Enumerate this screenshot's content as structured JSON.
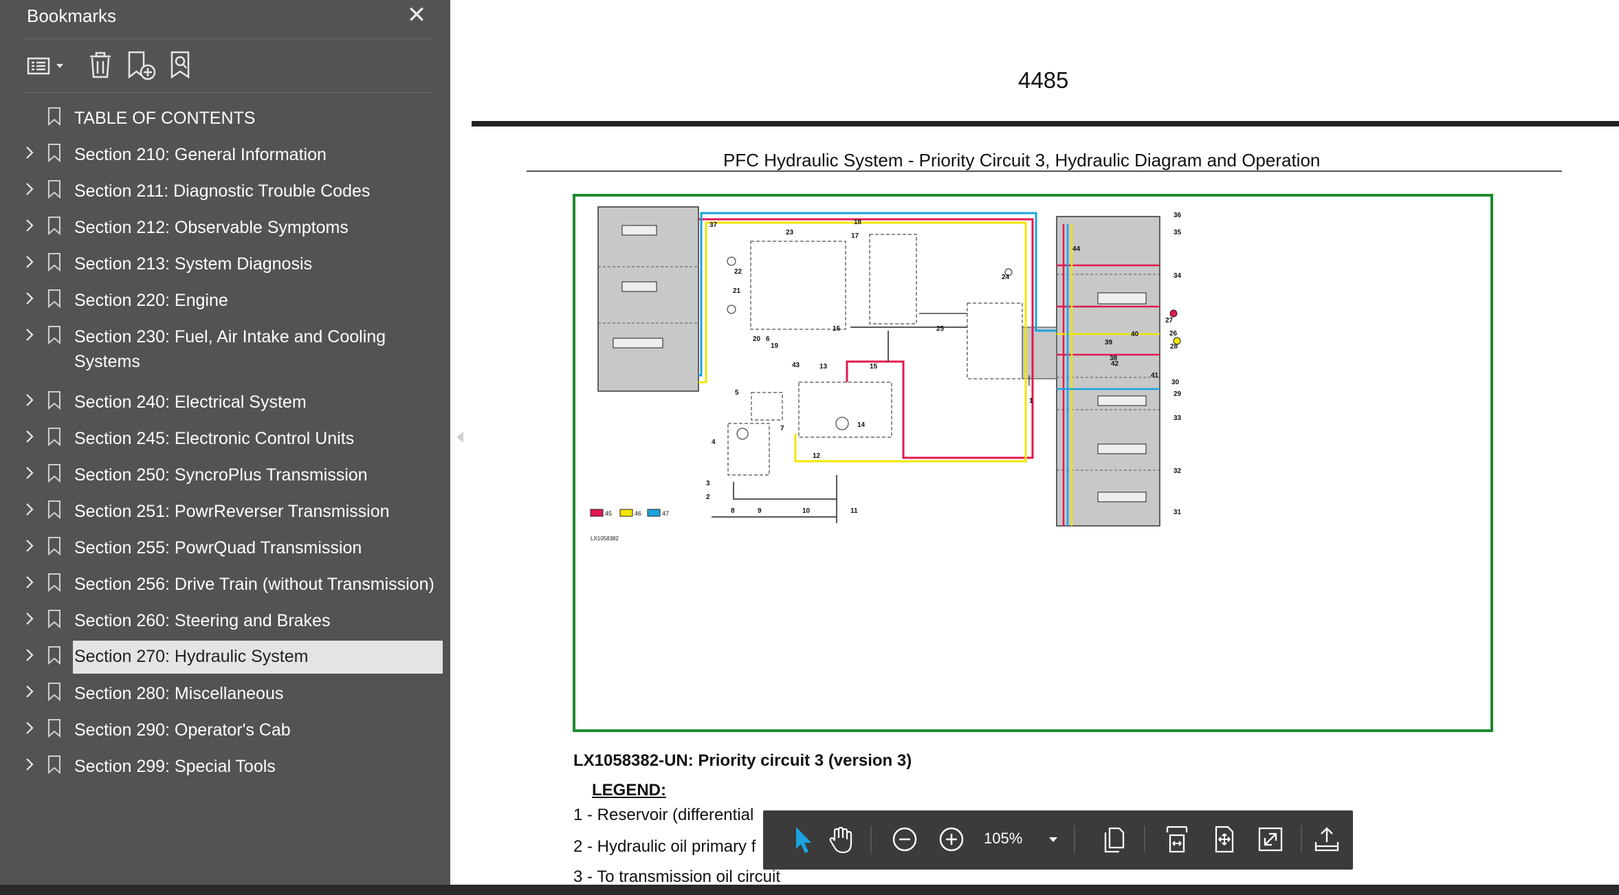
{
  "sidebar": {
    "title": "Bookmarks",
    "items": [
      {
        "label": "TABLE OF CONTENTS",
        "expandable": false
      },
      {
        "label": "Section 210: General Information",
        "expandable": true
      },
      {
        "label": "Section 211: Diagnostic Trouble Codes",
        "expandable": true
      },
      {
        "label": "Section 212: Observable Symptoms",
        "expandable": true
      },
      {
        "label": "Section 213: System Diagnosis",
        "expandable": true
      },
      {
        "label": "Section 220: Engine",
        "expandable": true
      },
      {
        "label": "Section 230: Fuel, Air Intake and Cooling Systems",
        "expandable": true
      },
      {
        "label": "Section 240: Electrical System",
        "expandable": true
      },
      {
        "label": "Section 245: Electronic Control Units",
        "expandable": true
      },
      {
        "label": "Section 250: SyncroPlus Transmission",
        "expandable": true
      },
      {
        "label": "Section 251: PowrReverser Transmission",
        "expandable": true
      },
      {
        "label": "Section 255: PowrQuad Transmission",
        "expandable": true
      },
      {
        "label": "Section 256: Drive Train (without Transmission)",
        "expandable": true
      },
      {
        "label": "Section 260: Steering and Brakes",
        "expandable": true
      },
      {
        "label": "Section 270: Hydraulic System",
        "expandable": true,
        "selected": true
      },
      {
        "label": "Section 280: Miscellaneous",
        "expandable": true
      },
      {
        "label": "Section 290: Operator's Cab",
        "expandable": true
      },
      {
        "label": "Section 299: Special Tools",
        "expandable": true
      }
    ]
  },
  "document": {
    "page_number": "4485",
    "title": "PFC Hydraulic System - Priority Circuit 3, Hydraulic Diagram and Operation",
    "figure_caption": "LX1058382-UN: Priority circuit 3 (version 3)",
    "figure_id": "LX1058382",
    "legend_heading": "LEGEND:",
    "legend_items": [
      "1 - Reservoir (differential",
      "2 - Hydraulic oil primary f",
      "3 - To transmission oil circuit"
    ],
    "diagram_legend": [
      {
        "label": "45",
        "color": "#e0194f"
      },
      {
        "label": "46",
        "color": "#f2e600"
      },
      {
        "label": "47",
        "color": "#1aa3e0"
      }
    ],
    "callouts": [
      "1",
      "2",
      "3",
      "4",
      "5",
      "6",
      "7",
      "8",
      "9",
      "10",
      "11",
      "12",
      "13",
      "14",
      "15",
      "16",
      "17",
      "18",
      "19",
      "20",
      "21",
      "22",
      "23",
      "24",
      "25",
      "26",
      "27",
      "28",
      "29",
      "30",
      "31",
      "32",
      "33",
      "34",
      "35",
      "36",
      "37",
      "38",
      "39",
      "40",
      "41",
      "42",
      "43",
      "44"
    ]
  },
  "toolbar": {
    "zoom": "105%",
    "accent": "#1aa3e0"
  }
}
